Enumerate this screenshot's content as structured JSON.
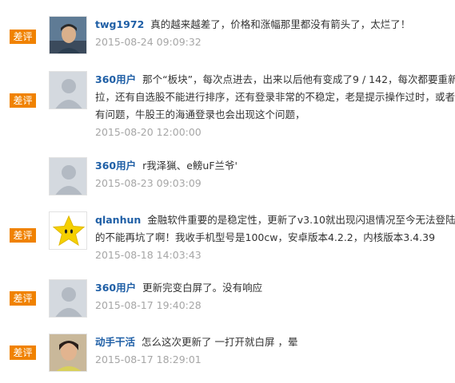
{
  "badge_label": "差评",
  "reviews": [
    {
      "user": "twg1972",
      "lines": [
        "真的越来越差了，价格和涨幅那里都没有箭头了，太烂了！"
      ],
      "date": "2015-08-24 09:09:32",
      "avatar": "photo-avatar",
      "badge": true
    },
    {
      "user": "360用户",
      "lines": [
        "那个“板块”，每次点进去，出来以后他有变成了9 / 142，每次都要重新下",
        "拉，还有自选股不能进行排序，还有登录非常的不稳定，老是提示操作过时，或者网络",
        "有问题，牛股王的海通登录也会出现这个问题，"
      ],
      "date": "2015-08-20 12:00:00",
      "avatar": "default-avatar",
      "badge": true
    },
    {
      "user": "360用户",
      "lines": [
        "r我泽猟、e鳑uF兰爷'"
      ],
      "date": "2015-08-23 09:03:09",
      "avatar": "default-avatar",
      "badge": false
    },
    {
      "user": "qlanhun",
      "lines": [
        "金融软件重要的是稳定性，更新了v3.10就出现闪退情况至今无法登陆。真",
        "的不能再坑了啊！我收手机型号是100cw，安卓版本4.2.2，内核版本3.4.39"
      ],
      "date": "2015-08-18 14:03:43",
      "avatar": "star-avatar",
      "badge": true
    },
    {
      "user": "360用户",
      "lines": [
        "更新完变白屏了。没有响应"
      ],
      "date": "2015-08-17 19:40:28",
      "avatar": "default-avatar",
      "badge": true
    },
    {
      "user": "动手干活",
      "lines": [
        "怎么这次更新了 一打开就白屏 ，晕"
      ],
      "date": "2015-08-17 18:29:01",
      "avatar": "photo-avatar",
      "badge": true
    }
  ]
}
